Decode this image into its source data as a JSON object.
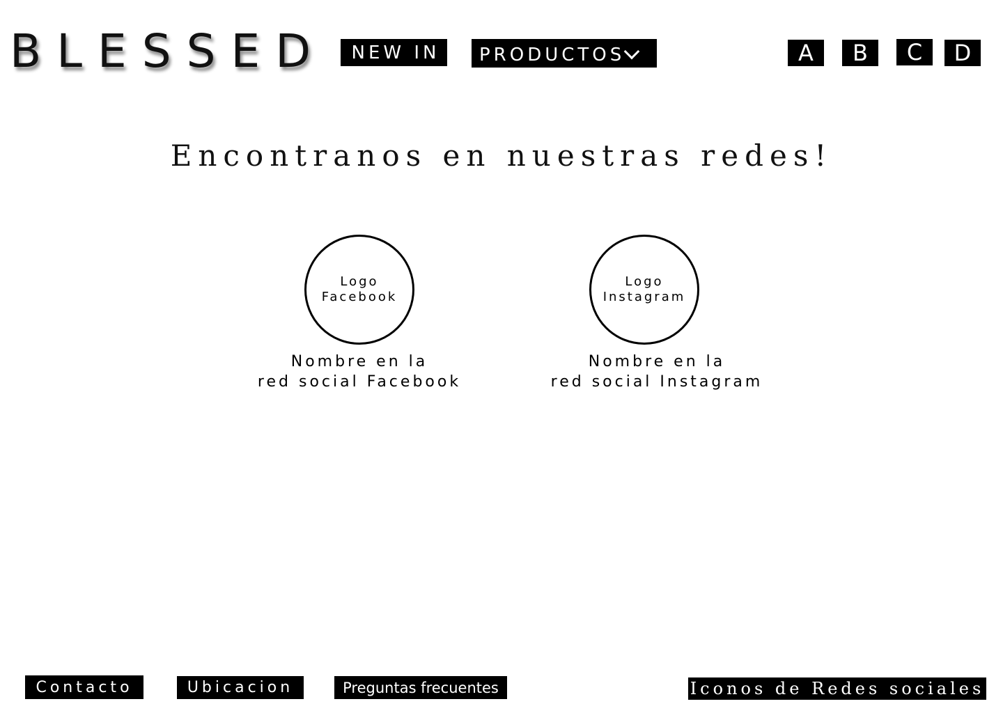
{
  "header": {
    "brand": "BLESSED",
    "nav": {
      "new_in": "NEW IN",
      "productos": "PRODUCTOS"
    },
    "quick_buttons": [
      "A",
      "B",
      "C",
      "D"
    ]
  },
  "main": {
    "headline": "Encontranos en nuestras redes!",
    "socials": [
      {
        "logo_line1": "Logo",
        "logo_line2": "Facebook",
        "name_line1": "Nombre en la",
        "name_line2": "red social Facebook"
      },
      {
        "logo_line1": "Logo",
        "logo_line2": "Instagram",
        "name_line1": "Nombre en la",
        "name_line2": "red social Instagram"
      }
    ]
  },
  "footer": {
    "contacto": "Contacto",
    "ubicacion": "Ubicacion",
    "faq": "Preguntas frecuentes",
    "iconos": "Iconos de Redes sociales"
  },
  "colors": {
    "background": "#ffffff",
    "button_bg": "#000000",
    "button_text": "#ffffff",
    "text": "#111111"
  }
}
